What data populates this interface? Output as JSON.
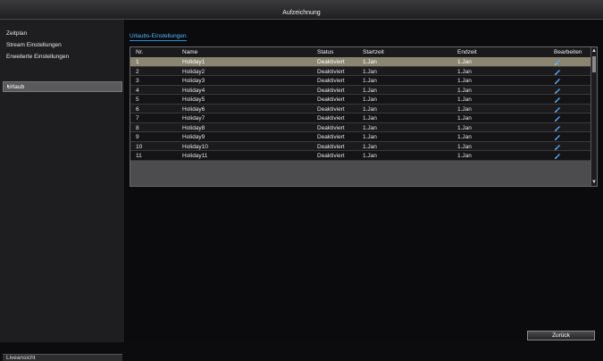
{
  "window": {
    "title": "Aufzeichnung"
  },
  "sidebar": {
    "items": [
      {
        "label": "Zeitplan"
      },
      {
        "label": "Stream Einstellungen"
      },
      {
        "label": "Erweiterte Einstellungen"
      },
      {
        "label": "Urlaub"
      }
    ],
    "active_index": 3,
    "footer_label": "Liveansicht"
  },
  "panel": {
    "tab_label": "Urlaubs-Einstellungen"
  },
  "table": {
    "columns": [
      "Nr.",
      "Name",
      "Status",
      "Startzeit",
      "Endzeit",
      "Bearbeiten"
    ],
    "rows": [
      {
        "nr": "1",
        "name": "Holiday1",
        "status": "Deaktiviert",
        "start": "1.Jan",
        "end": "1.Jan"
      },
      {
        "nr": "2",
        "name": "Holiday2",
        "status": "Deaktiviert",
        "start": "1.Jan",
        "end": "1.Jan"
      },
      {
        "nr": "3",
        "name": "Holiday3",
        "status": "Deaktiviert",
        "start": "1.Jan",
        "end": "1.Jan"
      },
      {
        "nr": "4",
        "name": "Holiday4",
        "status": "Deaktiviert",
        "start": "1.Jan",
        "end": "1.Jan"
      },
      {
        "nr": "5",
        "name": "Holiday5",
        "status": "Deaktiviert",
        "start": "1.Jan",
        "end": "1.Jan"
      },
      {
        "nr": "6",
        "name": "Holiday6",
        "status": "Deaktiviert",
        "start": "1.Jan",
        "end": "1.Jan"
      },
      {
        "nr": "7",
        "name": "Holiday7",
        "status": "Deaktiviert",
        "start": "1.Jan",
        "end": "1.Jan"
      },
      {
        "nr": "8",
        "name": "Holiday8",
        "status": "Deaktiviert",
        "start": "1.Jan",
        "end": "1.Jan"
      },
      {
        "nr": "9",
        "name": "Holiday9",
        "status": "Deaktiviert",
        "start": "1.Jan",
        "end": "1.Jan"
      },
      {
        "nr": "10",
        "name": "Holiday10",
        "status": "Deaktiviert",
        "start": "1.Jan",
        "end": "1.Jan"
      },
      {
        "nr": "11",
        "name": "Holiday11",
        "status": "Deaktiviert",
        "start": "1.Jan",
        "end": "1.Jan"
      }
    ],
    "selected_index": 0,
    "edit_icon": "pencil-icon"
  },
  "footer": {
    "back_label": "Zurück"
  },
  "colors": {
    "accent": "#4fb6ff",
    "selected_row": "#8a8571",
    "edit_icon": "#4aa8ff"
  }
}
